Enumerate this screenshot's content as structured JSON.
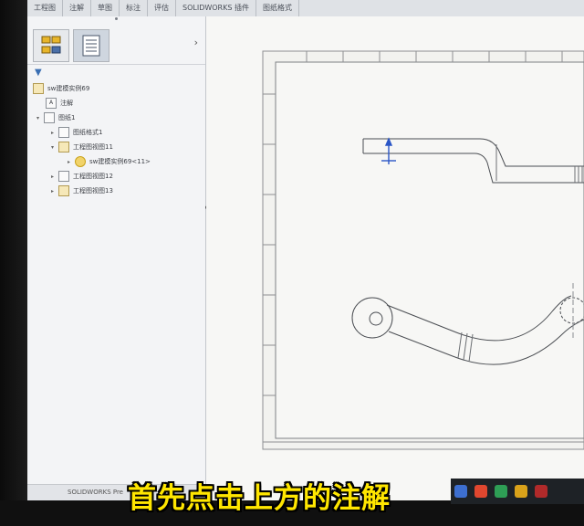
{
  "tabs": [
    "工程图",
    "注解",
    "草图",
    "标注",
    "评估",
    "SOLIDWORKS 插件",
    "图纸格式"
  ],
  "feature_tree": {
    "root": "sw建模实例69",
    "items": [
      {
        "label": "注解"
      },
      {
        "label": "图纸1"
      },
      {
        "label": "图纸格式1"
      },
      {
        "label": "工程图视图11"
      },
      {
        "label": "sw建模实例69<11>"
      },
      {
        "label": "工程图视图12"
      },
      {
        "label": "工程图视图13"
      }
    ]
  },
  "status_bar": {
    "label": "SOLIDWORKS Pre"
  },
  "caption": "首先点击上方的注解",
  "colors": {
    "caption": "#ffe600",
    "accent": "#3a6fb3"
  }
}
